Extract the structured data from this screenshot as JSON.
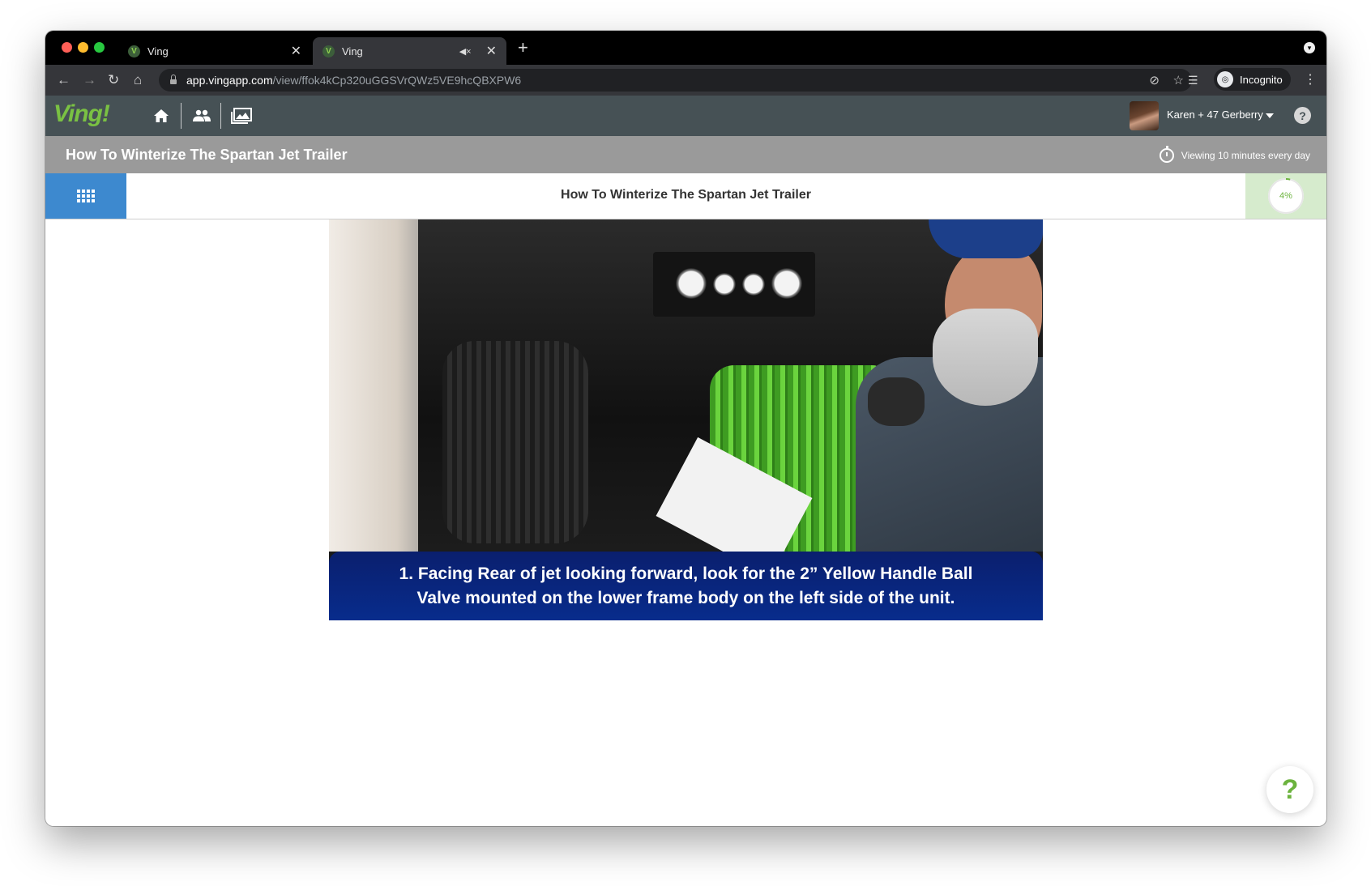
{
  "browser": {
    "tabs": [
      {
        "favicon": "V",
        "title": "Ving"
      },
      {
        "favicon": "V",
        "title": "Ving"
      }
    ],
    "url_host": "app.vingapp.com",
    "url_path": "/view/ffok4kCp320uGGSVrQWz5VE9hcQBXPW6",
    "incognito_label": "Incognito"
  },
  "app": {
    "logo": "Ving!",
    "user_name": "Karen + 47 Gerberry",
    "help_symbol": "?"
  },
  "content": {
    "page_title": "How To Winterize The Spartan Jet Trailer",
    "viewing_text": "Viewing 10 minutes every day",
    "step_title": "How To Winterize The Spartan Jet Trailer",
    "progress_label": "4%",
    "progress_value": 0.04,
    "caption_line1": "1. Facing Rear of jet looking forward, look for the 2” Yellow Handle Ball",
    "caption_line2": "Valve mounted on the lower frame body on the left side of the unit."
  },
  "floating_help": "?",
  "colors": {
    "appbar": "#465155",
    "titlebar": "#9a9a9a",
    "grid_button": "#3d89cf",
    "progress_bg": "#d6ebcd",
    "brand_green": "#7ac143",
    "caption_bg": "#0a1f6e"
  },
  "icons": [
    "home-icon",
    "people-icon",
    "gallery-icon",
    "grid-icon",
    "stopwatch-icon",
    "help-icon",
    "lock-icon",
    "star-icon",
    "eye-off-icon",
    "reading-list-icon",
    "back-icon",
    "forward-icon",
    "reload-icon"
  ]
}
